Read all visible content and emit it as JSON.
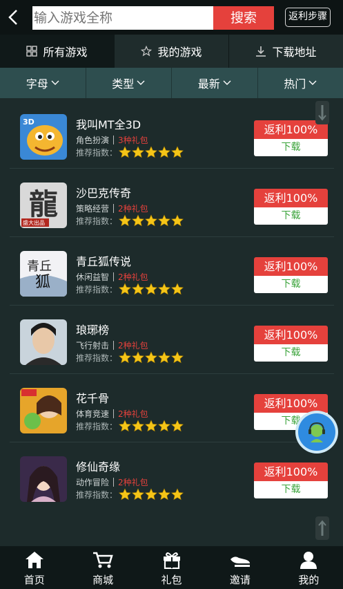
{
  "header": {
    "search_placeholder": "输入游戏全称",
    "search_label": "搜索",
    "fanli_steps_label": "返利步骤"
  },
  "tabs": [
    {
      "label": "所有游戏",
      "icon": "grid-icon",
      "active": true
    },
    {
      "label": "我的游戏",
      "icon": "star-outline-icon",
      "active": false
    },
    {
      "label": "下载地址",
      "icon": "download-icon",
      "active": false
    }
  ],
  "filters": [
    {
      "label": "字母"
    },
    {
      "label": "类型"
    },
    {
      "label": "最新"
    },
    {
      "label": "热门"
    }
  ],
  "games": [
    {
      "name": "我叫MT全3D",
      "genre": "角色扮演",
      "gifts": "3种礼包",
      "rating_label": "推荐指数：",
      "stars": 5,
      "fanli": "返利100%",
      "download": "下载"
    },
    {
      "name": "沙巴克传奇",
      "genre": "策略经营",
      "gifts": "2种礼包",
      "rating_label": "推荐指数：",
      "stars": 5,
      "fanli": "返利100%",
      "download": "下载"
    },
    {
      "name": "青丘狐传说",
      "genre": "休闲益智",
      "gifts": "2种礼包",
      "rating_label": "推荐指数：",
      "stars": 5,
      "fanli": "返利100%",
      "download": "下载"
    },
    {
      "name": "琅琊榜",
      "genre": "飞行射击",
      "gifts": "2种礼包",
      "rating_label": "推荐指数：",
      "stars": 5,
      "fanli": "返利100%",
      "download": "下载"
    },
    {
      "name": "花千骨",
      "genre": "体育竞速",
      "gifts": "2种礼包",
      "rating_label": "推荐指数：",
      "stars": 5,
      "fanli": "返利100%",
      "download": "下载"
    },
    {
      "name": "修仙奇缘",
      "genre": "动作冒险",
      "gifts": "2种礼包",
      "rating_label": "推荐指数：",
      "stars": 5,
      "fanli": "返利100%",
      "download": "下载"
    }
  ],
  "icon_texts": {
    "mt3d": "3D",
    "longzi": "龍",
    "shengda": "盛大出品",
    "qingqiu": "青丘",
    "hu": "狐"
  },
  "bottom_nav": [
    {
      "label": "首页",
      "icon": "home-icon"
    },
    {
      "label": "商城",
      "icon": "cart-icon"
    },
    {
      "label": "礼包",
      "icon": "gift-icon"
    },
    {
      "label": "邀请",
      "icon": "invite-icon"
    },
    {
      "label": "我的",
      "icon": "user-icon"
    }
  ],
  "colors": {
    "accent_red": "#e5413c",
    "download_green": "#3aa33a",
    "star_gold": "#f5c518",
    "filter_bar": "#2e4e4f"
  }
}
